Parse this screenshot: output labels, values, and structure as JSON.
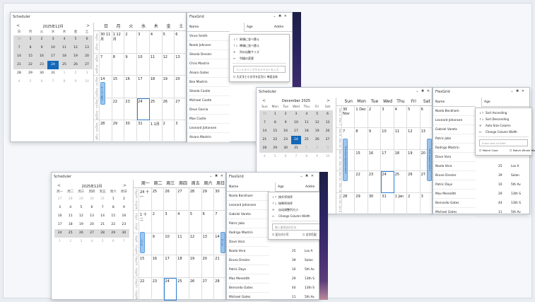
{
  "win_jp": {
    "title": "Scheduler",
    "controls": "⌄ ✖ ✕",
    "mini": {
      "month": "2025年12月",
      "prev": "<",
      "next": ">",
      "dow": [
        "日",
        "月",
        "火",
        "水",
        "木",
        "金",
        "土"
      ],
      "weeks": [
        [
          "30",
          "1",
          "2",
          "3",
          "4",
          "5",
          "6"
        ],
        [
          "7",
          "8",
          "9",
          "10",
          "11",
          "12",
          "13"
        ],
        [
          "14",
          "15",
          "16",
          "17",
          "18",
          "19",
          "20"
        ],
        [
          "21",
          "22",
          "23",
          "24",
          "25",
          "26",
          "27"
        ],
        [
          "28",
          "29",
          "30",
          "31",
          "1",
          "2",
          "3"
        ],
        [
          "4",
          "5",
          "6",
          "7",
          "8",
          "9",
          "10"
        ]
      ]
    },
    "hdr": [
      "日",
      "月",
      "火",
      "水",
      "木",
      "金",
      "土"
    ],
    "weeks": [
      [
        "30 11月",
        "1 12月",
        "2",
        "3",
        "4",
        "5",
        "6"
      ],
      [
        "7",
        "8",
        "9",
        "10",
        "11",
        "12",
        "13"
      ],
      [
        "14",
        "15",
        "16",
        "17",
        "18",
        "19",
        "20"
      ],
      [
        "21",
        "22",
        "23",
        "24",
        "25",
        "26",
        "27"
      ],
      [
        "28",
        "29",
        "30",
        "31",
        "1 1月",
        "2",
        "3"
      ]
    ],
    "wk": [
      "12月1 - 12月7",
      "12月8 - 12月14",
      "12月15 - 12月21",
      "12月22 - 12月28",
      "12月29 - 1月4"
    ],
    "pill1": "ケース一覧ト",
    "pill2": "ケース一覧"
  },
  "grid_jp": {
    "title": "FlexGrid",
    "controls": "⌄ ✖ ✕",
    "col_name": "Name",
    "col_age": "Age",
    "col_addr": "Addre",
    "names": [
      "Vince Smith",
      "Noela Johnsen",
      "Sheela Dresler",
      "Chris Mastrin",
      "Alvaro Gates",
      "Ben Mastrin",
      "Sheela Castle",
      "Michael Castle",
      "Dave Garcia",
      "Max Castle",
      "Leonard Johansen",
      "Alvaro Mastrin"
    ],
    "menu": [
      {
        "icon": "↓↑",
        "label": "昇順に並べ替え"
      },
      {
        "icon": "↑↓",
        "label": "降順に並べ替え"
      },
      {
        "icon": "✛",
        "label": "列の自動サイズ"
      },
      {
        "icon": "↔",
        "label": "列幅の変更"
      }
    ],
    "filter_ph": "フィルタリングするテキストを入力",
    "chk1": "大文字と小文字を区別",
    "chk2": "単語全体"
  },
  "win_en": {
    "title": "Scheduler",
    "controls": "⌄ ✖ ✕",
    "mini": {
      "month": "December 2025",
      "prev": "<",
      "next": ">",
      "dow": [
        "Sun",
        "Mon",
        "Tue",
        "Wed",
        "Thu",
        "Fri",
        "Sat"
      ],
      "weeks": [
        [
          "30",
          "1",
          "2",
          "3",
          "4",
          "5",
          "6"
        ],
        [
          "7",
          "8",
          "9",
          "10",
          "11",
          "12",
          "13"
        ],
        [
          "14",
          "15",
          "16",
          "17",
          "18",
          "19",
          "20"
        ],
        [
          "21",
          "22",
          "23",
          "24",
          "25",
          "26",
          "27"
        ],
        [
          "28",
          "29",
          "30",
          "31",
          "1",
          "2",
          "3"
        ],
        [
          "4",
          "5",
          "6",
          "7",
          "8",
          "9",
          "10"
        ]
      ]
    },
    "hdr": [
      "Sun",
      "Mon",
      "Tue",
      "Wed",
      "Thu",
      "Fri",
      "Sat"
    ],
    "weeks": [
      [
        "30 Nov",
        "1 Dec",
        "2",
        "3",
        "4",
        "5",
        "6"
      ],
      [
        "7",
        "8",
        "9",
        "10",
        "11",
        "12",
        "13"
      ],
      [
        "14",
        "15",
        "16",
        "17",
        "18",
        "19",
        "20"
      ],
      [
        "21",
        "22",
        "23",
        "24",
        "25",
        "26",
        "27"
      ],
      [
        "28",
        "29",
        "30",
        "31",
        "1 Jan",
        "2",
        "3"
      ]
    ],
    "wk": [
      "Dec 1 - Dec 7",
      "Dec 8 - Dec 14",
      "Dec 15 - Dec 21",
      "Dec 22 - Dec 28",
      "Dec 29 - Jan 4"
    ],
    "pill1": "Previous Appointment",
    "pill2": "Next Appointment"
  },
  "grid_en": {
    "title": "FlexGrid",
    "controls": "⌄ ✖ ✕",
    "col_name": "Name",
    "col_age": "Age",
    "names": [
      "Noela Beckham",
      "Leonard Johansen",
      "Gabriel Vareta",
      "Patric Jobs",
      "Rodrigo Mastrin",
      "Dave Vara",
      "Noela Vera",
      "Bruno Dresler",
      "Patric Days",
      "Max Meredith",
      "Bernardo Gates",
      "Michael Gates"
    ],
    "ages": [
      "",
      "",
      "",
      "",
      "",
      "",
      "25",
      "39",
      "10",
      "29",
      "44",
      "11"
    ],
    "addr": [
      "",
      "",
      "",
      "",
      "",
      "",
      "Los A",
      "Solan",
      "5th Av",
      "13th S",
      "13th S",
      "5th Av"
    ],
    "menu": [
      {
        "icon": "↓↑",
        "label": "Sort Ascending"
      },
      {
        "icon": "↑↓",
        "label": "Sort Descending"
      },
      {
        "icon": "✛",
        "label": "Auto-Size Column"
      },
      {
        "icon": "↔",
        "label": "Change Column Width"
      }
    ],
    "filter_ph": "Enter text to filter",
    "chk1": "Match Case",
    "chk2": "Match Whole Word"
  },
  "win_cn": {
    "title": "Scheduler",
    "controls": "⌄ ✖ ✕",
    "mini": {
      "month": "2025年12月",
      "prev": "<",
      "next": ">",
      "dow": [
        "周一",
        "周二",
        "周三",
        "周四",
        "周五",
        "周六",
        "周日"
      ],
      "weeks": [
        [
          "27",
          "28",
          "29",
          "30",
          "31",
          "1",
          "2"
        ],
        [
          "3",
          "4",
          "5",
          "6",
          "7",
          "8",
          "9"
        ],
        [
          "10",
          "11",
          "12",
          "13",
          "14",
          "15",
          "16"
        ],
        [
          "17",
          "18",
          "19",
          "20",
          "21",
          "22",
          "23"
        ],
        [
          "24",
          "25",
          "26",
          "27",
          "28",
          "29",
          "30"
        ],
        [
          "1",
          "2",
          "3",
          "4",
          "5",
          "6",
          "7"
        ]
      ]
    },
    "hdr": [
      "周一",
      "周二",
      "周三",
      "周四",
      "周五",
      "周六",
      "周日"
    ],
    "weeks": [
      [
        "24 十一",
        "25",
        "26",
        "27",
        "28",
        "29",
        "30"
      ],
      [
        "1 十二",
        "2",
        "3",
        "4",
        "5",
        "6",
        "7"
      ],
      [
        "8",
        "9",
        "10",
        "11",
        "12",
        "13",
        "14"
      ],
      [
        "15",
        "16",
        "17",
        "18",
        "19",
        "20",
        "21"
      ],
      [
        "22",
        "23",
        "24",
        "25",
        "26",
        "27",
        "28"
      ]
    ],
    "wk": [
      "11月24 - 11月30",
      "12月1 - 12月7",
      "12月8 - 12月14",
      "12月15 - 12月21",
      "12月22 - 12月28"
    ],
    "pill1": "上一个",
    "pill2": "下一个"
  },
  "grid_cn": {
    "title": "FlexGrid",
    "controls": "⌄ ✖ ✕",
    "col_name": "Name",
    "col_age": "Age",
    "col_addr": "Addre",
    "names": [
      "Noela Beckham",
      "Leonard Johansen",
      "Gabriel Vareta",
      "Patric Jobs",
      "Rodrigo Mastrin",
      "Dave Vara",
      "Noela Vera",
      "Bruno Dresler",
      "Patric Days",
      "Max Meredith",
      "Bernardo Gates",
      "Michael Gates"
    ],
    "ages": [
      "",
      "",
      "",
      "",
      "",
      "",
      "25",
      "39",
      "10",
      "29",
      "44",
      "11"
    ],
    "addr": [
      "",
      "",
      "",
      "",
      "",
      "",
      "Los A",
      "Solan",
      "5th Av",
      "13th S",
      "13th S",
      "5th Av"
    ],
    "menu": [
      {
        "icon": "↓↑",
        "label": "按升序排序"
      },
      {
        "icon": "↑↓",
        "label": "按降序排序"
      },
      {
        "icon": "✛",
        "label": "自动调整列大小"
      },
      {
        "icon": "↔",
        "label": "Change Column Width"
      }
    ],
    "filter_ph": "输入要筛选的文本",
    "chk1": "区分大小写",
    "chk2": "全字匹配"
  }
}
